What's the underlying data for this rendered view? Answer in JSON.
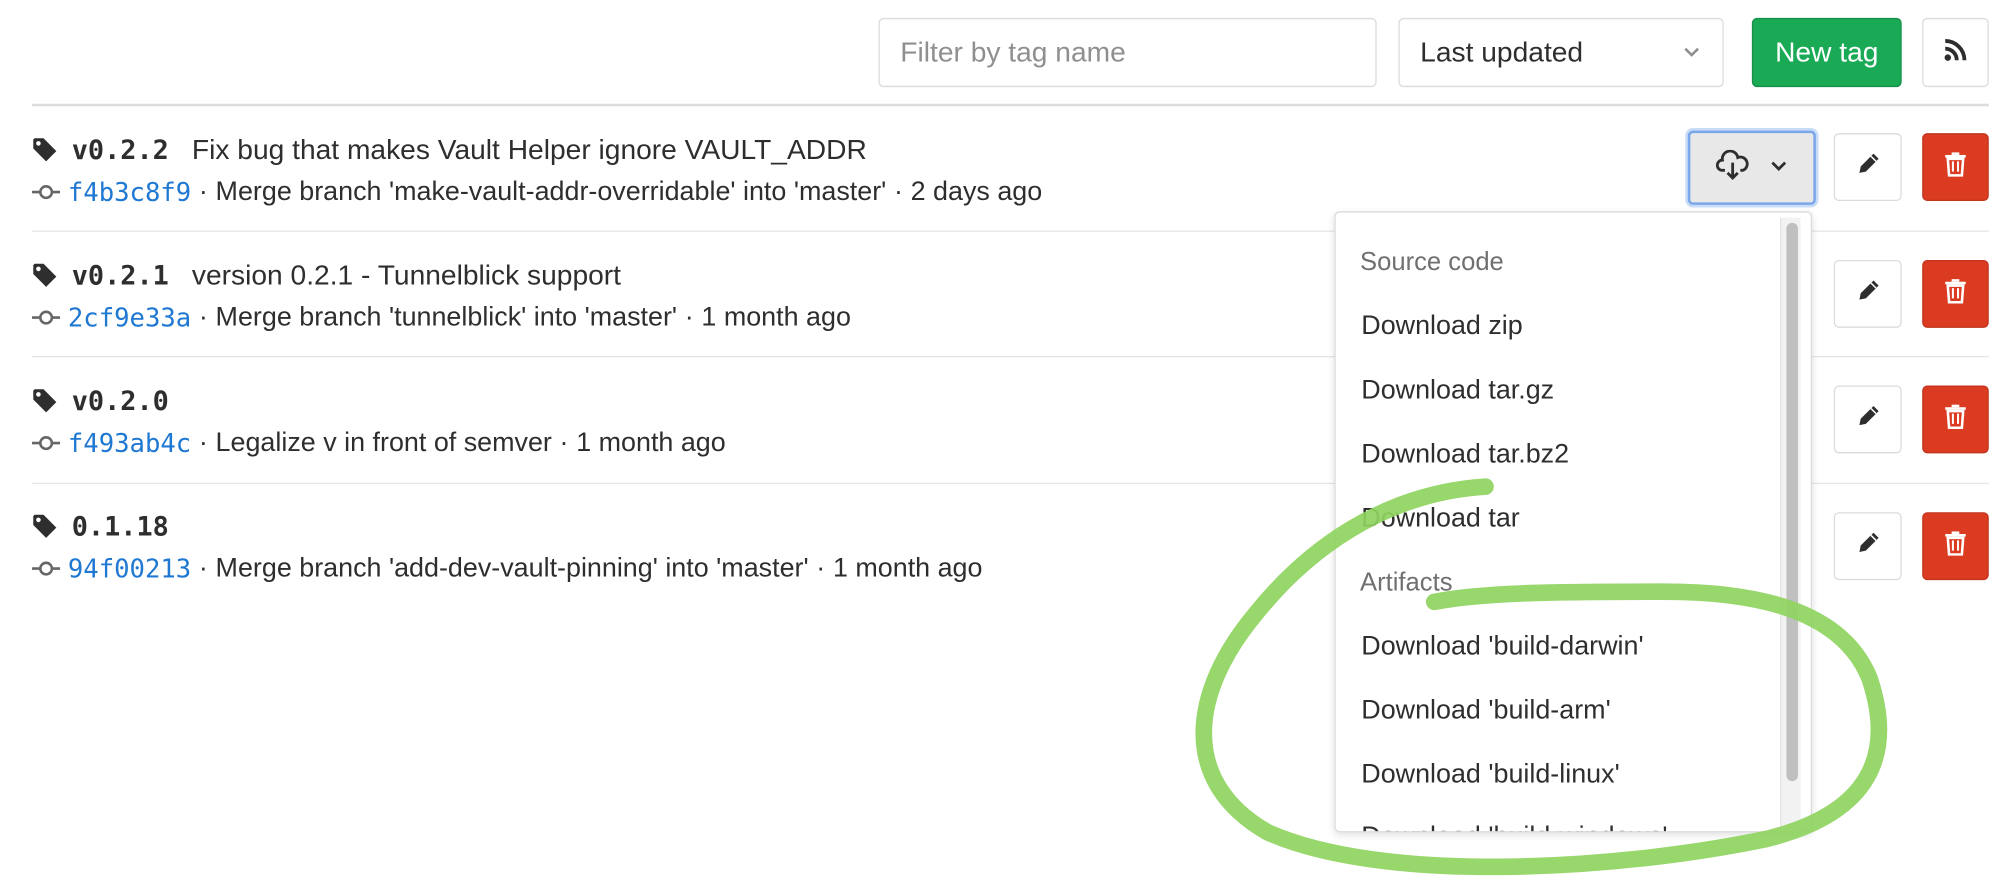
{
  "toolbar": {
    "filter_placeholder": "Filter by tag name",
    "sort_label": "Last updated",
    "new_tag_label": "New tag",
    "rss_icon": "rss-icon"
  },
  "tags": [
    {
      "name": "v0.2.2",
      "message": "Fix bug that makes Vault Helper ignore VAULT_ADDR",
      "sha": "f4b3c8f9",
      "commit_title": "Merge branch 'make-vault-addr-overridable' into 'master'",
      "time": "2 days ago"
    },
    {
      "name": "v0.2.1",
      "message": "version 0.2.1 - Tunnelblick support",
      "sha": "2cf9e33a",
      "commit_title": "Merge branch 'tunnelblick' into 'master'",
      "time": "1 month ago"
    },
    {
      "name": "v0.2.0",
      "message": "",
      "sha": "f493ab4c",
      "commit_title": "Legalize v in front of semver",
      "time": "1 month ago"
    },
    {
      "name": "0.1.18",
      "message": "",
      "sha": "94f00213",
      "commit_title": "Merge branch 'add-dev-vault-pinning' into 'master'",
      "time": "1 month ago"
    }
  ],
  "separator": "·",
  "download_dropdown": {
    "source_header": "Source code",
    "source_items": [
      "Download zip",
      "Download tar.gz",
      "Download tar.bz2",
      "Download tar"
    ],
    "artifacts_header": "Artifacts",
    "artifact_items": [
      "Download 'build-darwin'",
      "Download 'build-arm'",
      "Download 'build-linux'",
      "Download 'build-windows'"
    ]
  },
  "colors": {
    "new_tag_green": "#1aaa55",
    "delete_red": "#db3b21",
    "sha_link": "#1f78d1",
    "annotation_green": "#8fd45f"
  }
}
